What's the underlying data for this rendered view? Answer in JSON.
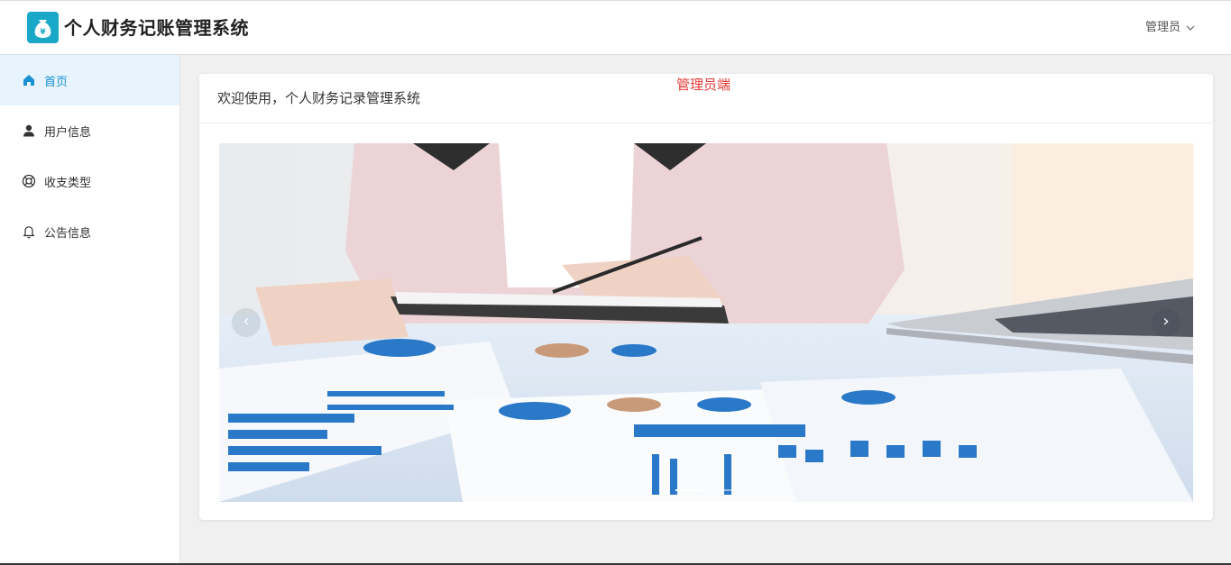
{
  "header": {
    "app_title": "个人财务记账管理系统",
    "logo_icon": "money-bag-icon",
    "logo_color": "#1aa8c8",
    "user_name": "管理员"
  },
  "sidebar": {
    "items": [
      {
        "label": "首页",
        "icon": "home-icon",
        "active": true
      },
      {
        "label": "用户信息",
        "icon": "user-icon",
        "active": false
      },
      {
        "label": "收支类型",
        "icon": "lifebuoy-icon",
        "active": false
      },
      {
        "label": "公告信息",
        "icon": "bell-icon",
        "active": false
      }
    ]
  },
  "main": {
    "welcome_text": "欢迎使用，个人财务记录管理系统",
    "role_tag": "管理员端",
    "role_tag_color": "#e53935",
    "carousel": {
      "slide_count": 2,
      "active_index": 0
    }
  },
  "colors": {
    "accent": "#1890d4",
    "active_bg": "#e8f4fd"
  }
}
